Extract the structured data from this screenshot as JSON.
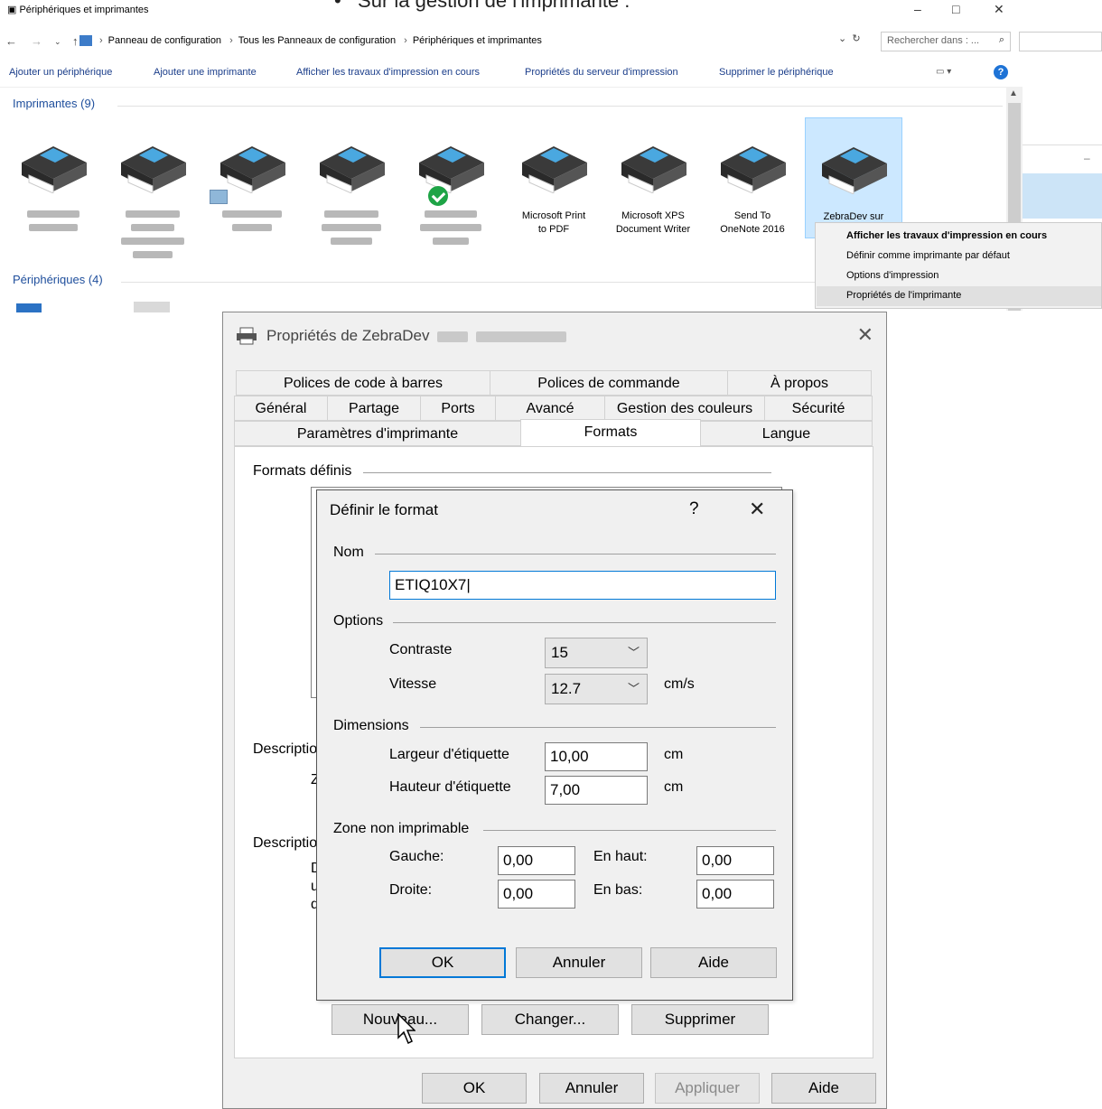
{
  "explorer": {
    "window_title": "Périphériques et imprimantes",
    "overlay_heading": "Sur la gestion de l'imprimante :",
    "breadcrumb": [
      "Panneau de configuration",
      "Tous les Panneaux de configuration",
      "Périphériques et imprimantes"
    ],
    "search_placeholder": "Rechercher dans : ...",
    "commands": [
      "Ajouter un périphérique",
      "Ajouter une imprimante",
      "Afficher les travaux d'impression en cours",
      "Propriétés du serveur d'impression",
      "Supprimer le périphérique"
    ],
    "printers_group": "Imprimantes (9)",
    "devices_group": "Périphériques (4)",
    "printers": [
      {
        "label": [
          "Microsoft Print",
          "to PDF"
        ]
      },
      {
        "label": [
          "Microsoft XPS",
          "Document Writer"
        ]
      },
      {
        "label": [
          "Send To",
          "OneNote 2016"
        ]
      },
      {
        "label": [
          "ZebraDev sur"
        ]
      }
    ],
    "icons": [
      "back-icon",
      "forward-icon",
      "up-icon",
      "refresh-icon",
      "search-icon",
      "help-icon",
      "printer-icon",
      "checkmark-icon"
    ],
    "accent_color": "#0078d7"
  },
  "context_menu": {
    "items": [
      "Afficher les travaux d'impression en cours",
      "Définir comme imprimante par défaut",
      "Options d'impression",
      "Propriétés de l'imprimante"
    ]
  },
  "properties_dialog": {
    "title": "Propriétés de ZebraDev",
    "tabs_row1": [
      "Polices de code à barres",
      "Polices de commande",
      "À propos"
    ],
    "tabs_row2": [
      "Général",
      "Partage",
      "Ports",
      "Avancé",
      "Gestion des couleurs",
      "Sécurité"
    ],
    "tabs_row3": [
      "Paramètres d'imprimante",
      "Formats",
      "Langue"
    ],
    "active_tab": "Formats",
    "formats_group": "Formats définis",
    "description_label_1": "Descriptio",
    "description_label_2": "Descriptio",
    "partial_z": "Z",
    "partial_d": "D",
    "partial_u": "u",
    "partial_q": "q",
    "buttons": {
      "new": "Nouveau...",
      "change": "Changer...",
      "delete": "Supprimer"
    },
    "footer": {
      "ok": "OK",
      "cancel": "Annuler",
      "apply": "Appliquer",
      "help": "Aide"
    }
  },
  "format_dialog": {
    "title": "Définir le format",
    "help_glyph": "?",
    "name_group": "Nom",
    "name_value": "ETIQ10X7",
    "options_group": "Options",
    "contrast_label": "Contraste",
    "contrast_value": "15",
    "speed_label": "Vitesse",
    "speed_value": "12.7",
    "speed_unit": "cm/s",
    "dimensions_group": "Dimensions",
    "width_label": "Largeur d'étiquette",
    "width_value": "10,00",
    "height_label": "Hauteur d'étiquette",
    "height_value": "7,00",
    "cm_unit": "cm",
    "margin_group": "Zone non imprimable",
    "left_label": "Gauche:",
    "left_value": "0,00",
    "top_label": "En haut:",
    "top_value": "0,00",
    "right_label": "Droite:",
    "right_value": "0,00",
    "bottom_label": "En bas:",
    "bottom_value": "0,00",
    "ok": "OK",
    "cancel": "Annuler",
    "help": "Aide"
  }
}
